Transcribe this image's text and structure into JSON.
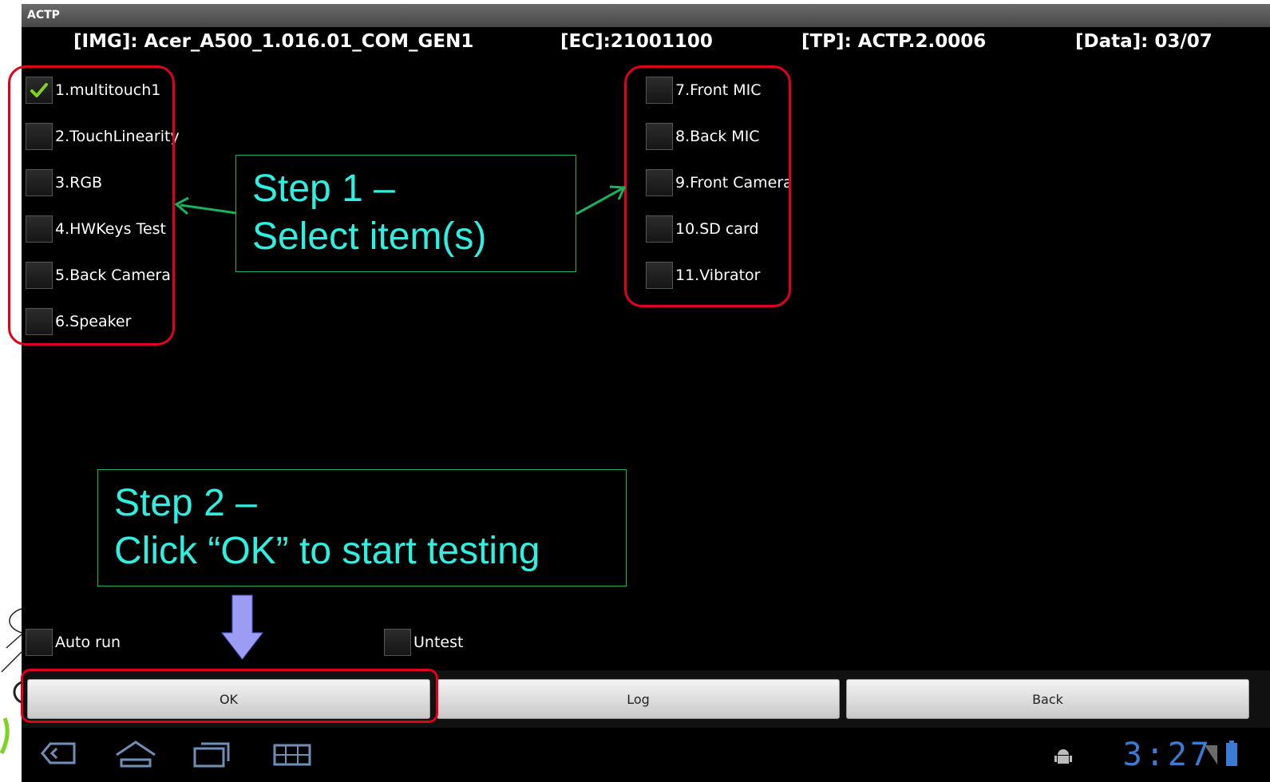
{
  "app_title": "ACTP",
  "header": {
    "img": "[IMG]: Acer_A500_1.016.01_COM_GEN1",
    "ec": "[EC]:21001100",
    "tp": "[TP]: ACTP.2.0006",
    "data": "[Data]: 03/07"
  },
  "items_left": [
    {
      "label": "1.multitouch1",
      "checked": true
    },
    {
      "label": "2.TouchLinearity",
      "checked": false
    },
    {
      "label": "3.RGB",
      "checked": false
    },
    {
      "label": "4.HWKeys Test",
      "checked": false
    },
    {
      "label": "5.Back Camera",
      "checked": false
    },
    {
      "label": "6.Speaker",
      "checked": false
    }
  ],
  "items_right": [
    {
      "label": "7.Front MIC",
      "checked": false
    },
    {
      "label": "8.Back MIC",
      "checked": false
    },
    {
      "label": "9.Front Camera",
      "checked": false
    },
    {
      "label": "10.SD card",
      "checked": false
    },
    {
      "label": "11.Vibrator",
      "checked": false
    }
  ],
  "options": {
    "auto_run": {
      "label": "Auto run",
      "checked": false
    },
    "untest": {
      "label": "Untest",
      "checked": false
    }
  },
  "callouts": {
    "step1": {
      "line1": "Step 1 –",
      "line2": "Select item(s)"
    },
    "step2": {
      "line1": "Step 2 –",
      "line2": "Click “OK” to start testing"
    }
  },
  "buttons": {
    "ok": "OK",
    "log": "Log",
    "back": "Back"
  },
  "statusbar": {
    "time": "3:27"
  },
  "icons": [
    "back-nav-icon",
    "home-nav-icon",
    "recent-apps-icon",
    "menu-grid-icon",
    "android-debug-icon",
    "signal-icon",
    "battery-icon",
    "checkmark-icon"
  ],
  "colors": {
    "highlight": "#e0001b",
    "callout_text": "#2ef0e0",
    "callout_border": "#18b35a",
    "arrow_fill": "#9c9cf5",
    "clock": "#3a7bd5"
  }
}
